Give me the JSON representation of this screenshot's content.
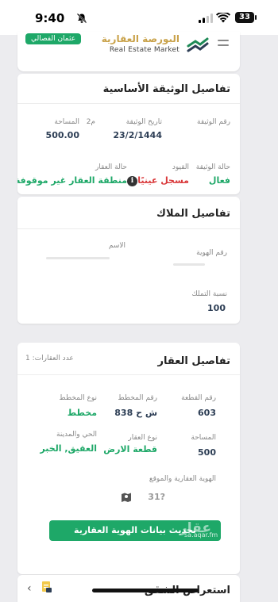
{
  "status_bar": {
    "time": "9:40",
    "battery": "33"
  },
  "header": {
    "logo_ar": "البورصة العقارية",
    "logo_en": "Real Estate Market",
    "user_badge": "عثمان الفصالي"
  },
  "deed": {
    "title": "تفاصيل الوثيقة الأساسية",
    "deed_number_label": "رقم الوثيقة",
    "deed_date_label": "تاريخ الوثيقة",
    "deed_date_value": "23/2/1444",
    "area_label": "المساحة",
    "area_unit": "م2",
    "area_value": "500.00",
    "deed_status_label": "حالة الوثيقة",
    "deed_status_value": "فعال",
    "restrictions_label": "القيود",
    "restrictions_value": "مسجل عينيًا",
    "property_status_label": "حالة العقار",
    "property_status_value": "منطقة العقار غير موقوفة"
  },
  "owners": {
    "title": "تفاصيل الملاك",
    "name_label": "الاسم",
    "id_label": "رقم الهوية",
    "share_label": "نسبة التملك",
    "share_value": "100"
  },
  "property": {
    "title": "تفاصيل العقار",
    "count_label": "عدد العقارات: 1",
    "plot_number_label": "رقم القطعة",
    "plot_number_value": "603",
    "plan_number_label": "رقم المخطط",
    "plan_number_value": "ش ح 838",
    "plan_type_label": "نوع المخطط",
    "plan_type_value": "مخطط",
    "area_label": "المساحة",
    "area_value": "500",
    "property_type_label": "نوع العقار",
    "property_type_value": "قطعة الارض",
    "district_label": "الحي والمدينة",
    "district_value": "العقيق, الخبر",
    "location_label": "الهوية العقارية والموقع",
    "location_value": "31?",
    "update_button": "تحديث بيانات الهوية العقارية"
  },
  "bottom": {
    "title": "استعراض الشقق"
  },
  "watermark": {
    "brand": "عقار",
    "url": "sa.aqar.fm"
  }
}
